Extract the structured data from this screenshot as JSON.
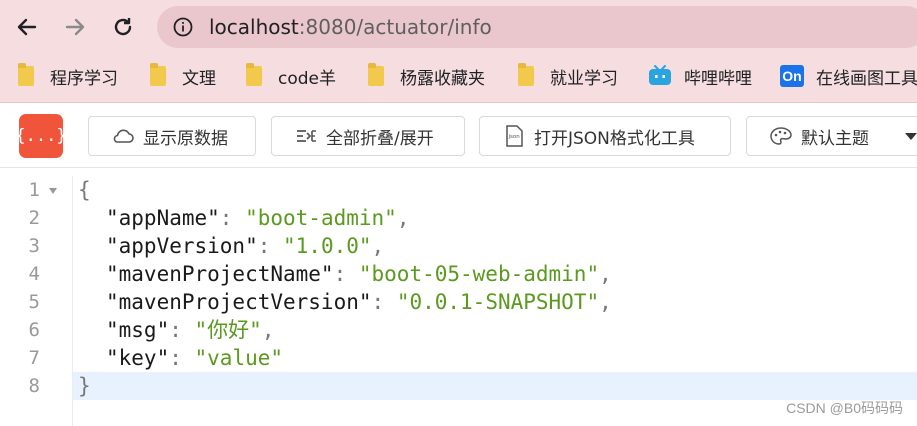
{
  "browser": {
    "url_host": "localhost",
    "url_rest": ":8080/actuator/info",
    "bookmarks": [
      "程序学习",
      "文理",
      "code羊",
      "杨露收藏夹",
      "就业学习",
      "哔哩哔哩",
      "在线画图工具"
    ],
    "bookmark_icon_on": "On"
  },
  "toolbar": {
    "logo": "{...}",
    "raw_label": "显示原数据",
    "collapse_label": "全部折叠/展开",
    "json_label": "打开JSON格式化工具",
    "theme_label": "默认主题"
  },
  "json": {
    "open_brace": "{",
    "close_brace": "}",
    "entries": [
      {
        "key": "\"appName\"",
        "value": "\"boot-admin\"",
        "comma": true
      },
      {
        "key": "\"appVersion\"",
        "value": "\"1.0.0\"",
        "comma": true
      },
      {
        "key": "\"mavenProjectName\"",
        "value": "\"boot-05-web-admin\"",
        "comma": true
      },
      {
        "key": "\"mavenProjectVersion\"",
        "value": "\"0.0.1-SNAPSHOT\"",
        "comma": true
      },
      {
        "key": "\"msg\"",
        "value": "\"你好\"",
        "comma": true
      },
      {
        "key": "\"key\"",
        "value": "\"value\"",
        "comma": false
      }
    ],
    "line_numbers": [
      "1",
      "2",
      "3",
      "4",
      "5",
      "6",
      "7",
      "8"
    ]
  },
  "watermark": "CSDN @B0码码码",
  "colors": {
    "logo": "#f0553b",
    "string": "#5a9a1e",
    "chrome": "#f5dde0"
  }
}
